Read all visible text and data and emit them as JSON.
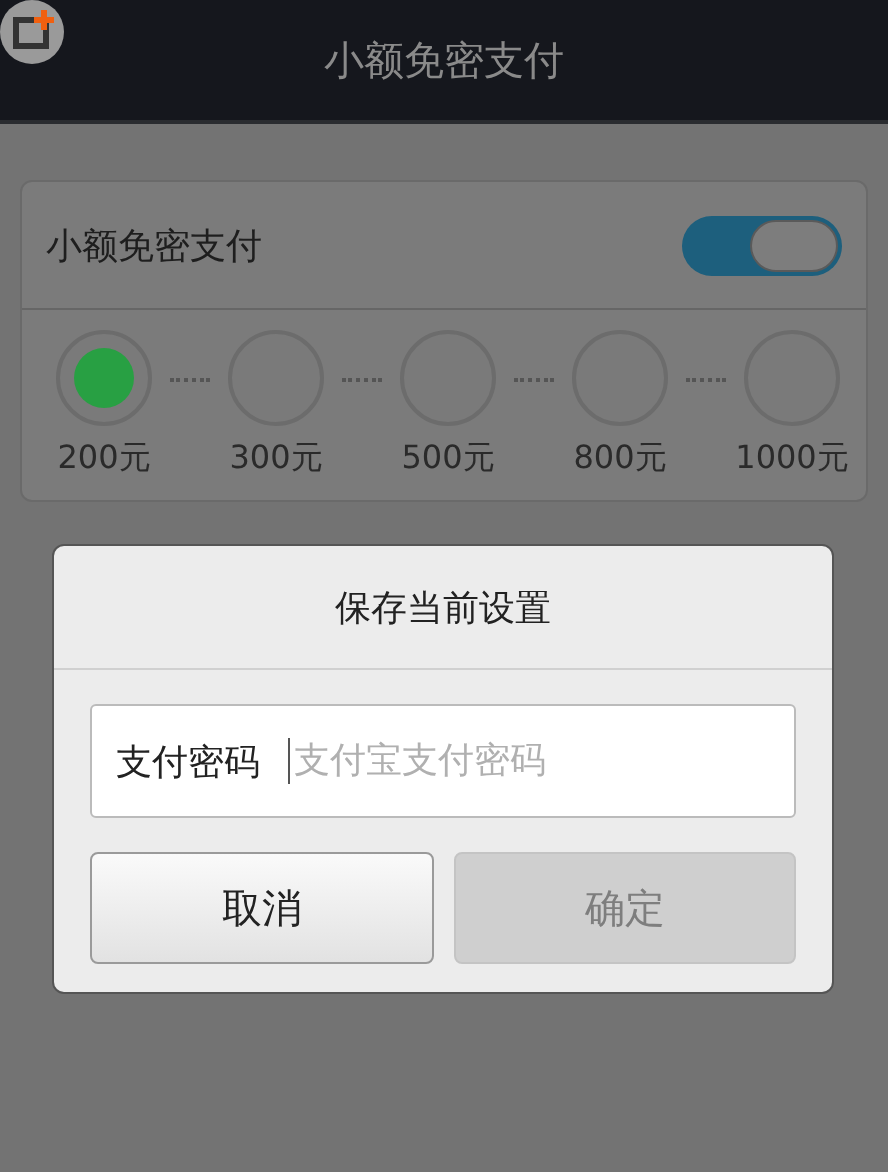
{
  "header": {
    "title": "小额免密支付"
  },
  "setting": {
    "label": "小额免密支付",
    "on": true
  },
  "amounts": [
    {
      "label": "200元",
      "selected": true
    },
    {
      "label": "300元",
      "selected": false
    },
    {
      "label": "500元",
      "selected": false
    },
    {
      "label": "800元",
      "selected": false
    },
    {
      "label": "1000元",
      "selected": false
    }
  ],
  "dialog": {
    "title": "保存当前设置",
    "field_label": "支付密码",
    "placeholder": "支付宝支付密码",
    "buttons": [
      {
        "label": "取消",
        "disabled": false
      },
      {
        "label": "确定",
        "disabled": true
      }
    ]
  }
}
